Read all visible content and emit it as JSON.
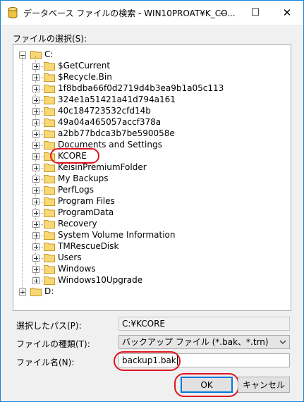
{
  "window": {
    "title": "データベース ファイルの検索 - WIN10PROAT¥K_CO...",
    "minimize_glyph": "—",
    "maximize_glyph": "☐",
    "close_glyph": "✕"
  },
  "labels": {
    "select_file": "ファイルの選択(S):",
    "selected_path": "選択したパス(P):",
    "file_type": "ファイルの種類(T):",
    "file_name": "ファイル名(N):"
  },
  "tree": {
    "root_c": "C:",
    "c_children": [
      "$GetCurrent",
      "$Recycle.Bin",
      "1f8bdba66f0d2719d4b3ea9b1a05c113",
      "324e1a51421a41d794a161",
      "40c184723532cfd14b",
      "49a04a465057accf378a",
      "a2bb77bdca3b7be590058e",
      "Documents and Settings",
      "KCORE",
      "KeisinPremiumFolder",
      "My Backups",
      "PerfLogs",
      "Program Files",
      "ProgramData",
      "Recovery",
      "System Volume Information",
      "TMRescueDisk",
      "Users",
      "Windows",
      "Windows10Upgrade"
    ],
    "root_d": "D:"
  },
  "fields": {
    "selected_path_value": "C:¥KCORE",
    "file_type_value": "バックアップ ファイル (*.bak、*.trn)",
    "file_name_value": "backup1.bak"
  },
  "buttons": {
    "ok": "OK",
    "cancel": "キャンセル"
  },
  "colors": {
    "accent": "#0078d7",
    "highlight_annotation": "#e0141e",
    "folder": "#f8d775"
  }
}
